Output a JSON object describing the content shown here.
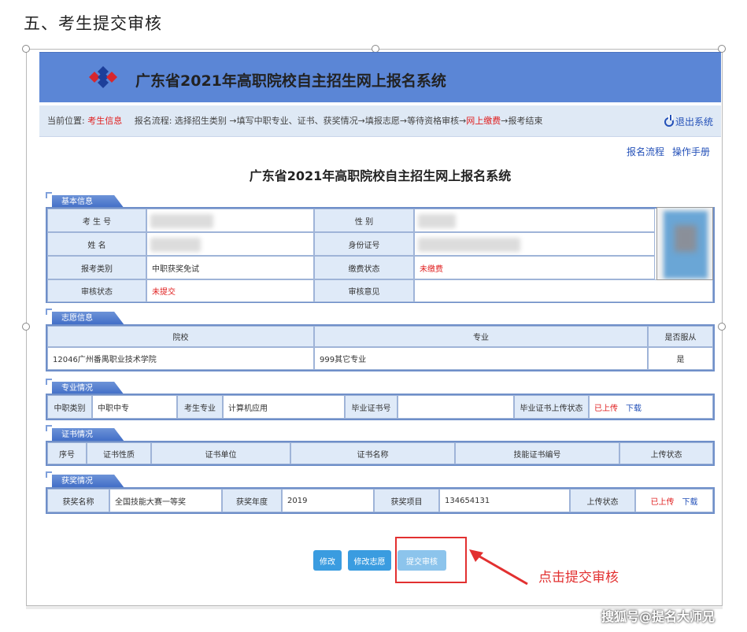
{
  "doc_heading": "五、考生提交审核",
  "banner": {
    "title": "广东省2021年高职院校自主招生网上报名系统",
    "colors": {
      "banner_bg": "#5b86d6",
      "accent_red": "#e02020",
      "link_blue": "#2350b8"
    }
  },
  "crumb": {
    "position_label": "当前位置:",
    "position_value": "考生信息",
    "flow_prefix": "报名流程: 选择招生类别 →填写中职专业、证书、获奖情况→填报志愿→等待资格审核→",
    "flow_current": "网上缴费",
    "flow_suffix": "→报考结束",
    "logout": "退出系统"
  },
  "top_links": {
    "process": "报名流程",
    "manual": "操作手册"
  },
  "page_title": "广东省2021年高职院校自主招生网上报名系统",
  "basic": {
    "section": "基本信息",
    "exam_no_label": "考 生 号",
    "gender_label": "性    别",
    "name_label": "姓    名",
    "id_label": "身份证号",
    "category_label": "报考类别",
    "category_value": "中职获奖免试",
    "pay_label": "缴费状态",
    "pay_value": "未缴费",
    "audit_label": "审核状态",
    "audit_value": "未提交",
    "opinion_label": "审核意见"
  },
  "choice": {
    "section": "志愿信息",
    "headers": [
      "院校",
      "专业",
      "是否服从"
    ],
    "row": [
      "12046广州番禺职业技术学院",
      "999其它专业",
      "是"
    ]
  },
  "major": {
    "section": "专业情况",
    "cat_label": "中职类别",
    "cat_value": "中职中专",
    "major_label": "考生专业",
    "major_value": "计算机应用",
    "cert_no_label": "毕业证书号",
    "upload_label": "毕业证书上传状态",
    "upload_value": "已上传",
    "download": "下载"
  },
  "cert": {
    "section": "证书情况",
    "headers": [
      "序号",
      "证书性质",
      "证书单位",
      "证书名称",
      "技能证书编号",
      "上传状态"
    ]
  },
  "award": {
    "section": "获奖情况",
    "name_label": "获奖名称",
    "name_value": "全国技能大赛一等奖",
    "year_label": "获奖年度",
    "year_value": "2019",
    "item_label": "获奖项目",
    "item_value": "134654131",
    "upload_label": "上传状态",
    "upload_value": "已上传",
    "download": "下载"
  },
  "buttons": {
    "modify": "修改",
    "modify_choice": "修改志愿",
    "submit": "提交审核"
  },
  "callout": "点击提交审核",
  "watermark": "搜狐号@提名大师兄"
}
